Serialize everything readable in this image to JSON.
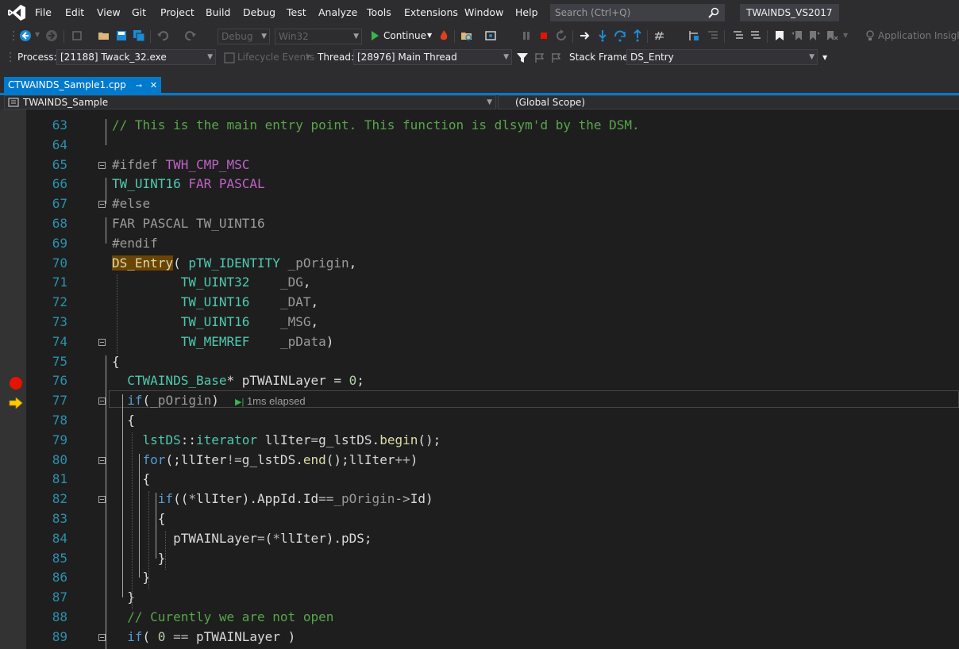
{
  "menubar": {
    "items": [
      "File",
      "Edit",
      "View",
      "Git",
      "Project",
      "Build",
      "Debug",
      "Test",
      "Analyze",
      "Tools",
      "Extensions",
      "Window",
      "Help"
    ],
    "search_placeholder": "Search (Ctrl+Q)",
    "solution_name": "TWAINDS_VS2017"
  },
  "toolbar": {
    "config": "Debug",
    "platform": "Win32",
    "continue_label": "Continue",
    "insights_label": "Application Insights"
  },
  "debug_location": {
    "process_label": "Process:",
    "process_value": "[21188] Twack_32.exe",
    "lifecycle_label": "Lifecycle Events",
    "thread_label": "Thread:",
    "thread_value": "[28976] Main Thread",
    "stackframe_label": "Stack Frame:",
    "stackframe_value": "DS_Entry"
  },
  "tab": {
    "filename": "CTWAINDS_Sample1.cpp",
    "pin": "⊸",
    "close": "✕"
  },
  "navbar": {
    "project": "TWAINDS_Sample",
    "scope": "(Global Scope)"
  },
  "perf_tip": "1ms elapsed",
  "colors": {
    "accent": "#007acc",
    "breakpoint": "#e51400",
    "current_line_arrow": "#ffcc00"
  },
  "code_lines": [
    {
      "n": "63",
      "tokens": [
        {
          "c": "cm",
          "t": "// This is the main entry point. This function is dlsym'd by the DSM."
        }
      ]
    },
    {
      "n": "64",
      "tokens": []
    },
    {
      "n": "65",
      "tokens": [
        {
          "c": "pp",
          "t": "#ifdef "
        },
        {
          "c": "mac",
          "t": "TWH_CMP_MSC"
        }
      ]
    },
    {
      "n": "66",
      "tokens": [
        {
          "c": "ty",
          "t": "TW_UINT16"
        },
        {
          "c": "",
          "t": " "
        },
        {
          "c": "mac",
          "t": "FAR"
        },
        {
          "c": "",
          "t": " "
        },
        {
          "c": "mac",
          "t": "PASCAL"
        }
      ]
    },
    {
      "n": "67",
      "tokens": [
        {
          "c": "pp",
          "t": "#else"
        }
      ]
    },
    {
      "n": "68",
      "tokens": [
        {
          "c": "pp",
          "t": "FAR PASCAL TW_UINT16"
        }
      ]
    },
    {
      "n": "69",
      "tokens": [
        {
          "c": "pp",
          "t": "#endif"
        }
      ]
    },
    {
      "n": "70",
      "tokens": [
        {
          "c": "fn highlight-entry",
          "t": "DS_Entry"
        },
        {
          "c": "",
          "t": "( "
        },
        {
          "c": "ty",
          "t": "pTW_IDENTITY"
        },
        {
          "c": "par",
          "t": " _pOrigin"
        },
        {
          "c": "",
          "t": ","
        }
      ]
    },
    {
      "n": "71",
      "tokens": [
        {
          "c": "",
          "t": "         "
        },
        {
          "c": "ty",
          "t": "TW_UINT32"
        },
        {
          "c": "par",
          "t": "    _DG"
        },
        {
          "c": "",
          "t": ","
        }
      ]
    },
    {
      "n": "72",
      "tokens": [
        {
          "c": "",
          "t": "         "
        },
        {
          "c": "ty",
          "t": "TW_UINT16"
        },
        {
          "c": "par",
          "t": "    _DAT"
        },
        {
          "c": "",
          "t": ","
        }
      ]
    },
    {
      "n": "73",
      "tokens": [
        {
          "c": "",
          "t": "         "
        },
        {
          "c": "ty",
          "t": "TW_UINT16"
        },
        {
          "c": "par",
          "t": "    _MSG"
        },
        {
          "c": "",
          "t": ","
        }
      ]
    },
    {
      "n": "74",
      "tokens": [
        {
          "c": "",
          "t": "         "
        },
        {
          "c": "ty",
          "t": "TW_MEMREF"
        },
        {
          "c": "par",
          "t": "    _pData"
        },
        {
          "c": "",
          "t": ")"
        }
      ]
    },
    {
      "n": "75",
      "tokens": [
        {
          "c": "",
          "t": "{"
        }
      ]
    },
    {
      "n": "76",
      "tokens": [
        {
          "c": "",
          "t": "  "
        },
        {
          "c": "ty",
          "t": "CTWAINDS_Base"
        },
        {
          "c": "",
          "t": "* "
        },
        {
          "c": "glob",
          "t": "pTWAINLayer"
        },
        {
          "c": "",
          "t": " = "
        },
        {
          "c": "num",
          "t": "0"
        },
        {
          "c": "",
          "t": ";"
        }
      ]
    },
    {
      "n": "77",
      "tokens": [
        {
          "c": "",
          "t": "  "
        },
        {
          "c": "kw",
          "t": "if"
        },
        {
          "c": "",
          "t": "("
        },
        {
          "c": "par",
          "t": "_pOrigin"
        },
        {
          "c": "",
          "t": ")"
        }
      ]
    },
    {
      "n": "78",
      "tokens": [
        {
          "c": "",
          "t": "  {"
        }
      ]
    },
    {
      "n": "79",
      "tokens": [
        {
          "c": "",
          "t": "    "
        },
        {
          "c": "ty",
          "t": "lstDS"
        },
        {
          "c": "",
          "t": "::"
        },
        {
          "c": "ty",
          "t": "iterator"
        },
        {
          "c": "",
          "t": " "
        },
        {
          "c": "glob",
          "t": "llIter"
        },
        {
          "c": "op",
          "t": "="
        },
        {
          "c": "glob",
          "t": "g_lstDS"
        },
        {
          "c": "",
          "t": "."
        },
        {
          "c": "fn",
          "t": "begin"
        },
        {
          "c": "",
          "t": "();"
        }
      ]
    },
    {
      "n": "80",
      "tokens": [
        {
          "c": "",
          "t": "    "
        },
        {
          "c": "kw",
          "t": "for"
        },
        {
          "c": "",
          "t": "(;"
        },
        {
          "c": "glob",
          "t": "llIter"
        },
        {
          "c": "op",
          "t": "!="
        },
        {
          "c": "glob",
          "t": "g_lstDS"
        },
        {
          "c": "",
          "t": "."
        },
        {
          "c": "fn",
          "t": "end"
        },
        {
          "c": "",
          "t": "();"
        },
        {
          "c": "glob",
          "t": "llIter"
        },
        {
          "c": "op",
          "t": "++"
        },
        {
          "c": "",
          "t": ")"
        }
      ]
    },
    {
      "n": "81",
      "tokens": [
        {
          "c": "",
          "t": "    {"
        }
      ]
    },
    {
      "n": "82",
      "tokens": [
        {
          "c": "",
          "t": "      "
        },
        {
          "c": "kw",
          "t": "if"
        },
        {
          "c": "",
          "t": "(("
        },
        {
          "c": "op",
          "t": "*"
        },
        {
          "c": "glob",
          "t": "llIter"
        },
        {
          "c": "",
          "t": ").AppId.Id"
        },
        {
          "c": "op",
          "t": "=="
        },
        {
          "c": "par",
          "t": "_pOrigin"
        },
        {
          "c": "op",
          "t": "->"
        },
        {
          "c": "",
          "t": "Id)"
        }
      ]
    },
    {
      "n": "83",
      "tokens": [
        {
          "c": "",
          "t": "      {"
        }
      ]
    },
    {
      "n": "84",
      "tokens": [
        {
          "c": "",
          "t": "        "
        },
        {
          "c": "glob",
          "t": "pTWAINLayer"
        },
        {
          "c": "op",
          "t": "="
        },
        {
          "c": "",
          "t": "("
        },
        {
          "c": "op",
          "t": "*"
        },
        {
          "c": "glob",
          "t": "llIter"
        },
        {
          "c": "",
          "t": ").pDS;"
        }
      ]
    },
    {
      "n": "85",
      "tokens": [
        {
          "c": "",
          "t": "      }"
        }
      ]
    },
    {
      "n": "86",
      "tokens": [
        {
          "c": "",
          "t": "    }"
        }
      ]
    },
    {
      "n": "87",
      "tokens": [
        {
          "c": "",
          "t": "  }"
        }
      ]
    },
    {
      "n": "88",
      "tokens": [
        {
          "c": "",
          "t": "  "
        },
        {
          "c": "cm",
          "t": "// Curently we are not open"
        }
      ]
    },
    {
      "n": "89",
      "tokens": [
        {
          "c": "",
          "t": "  "
        },
        {
          "c": "kw",
          "t": "if"
        },
        {
          "c": "",
          "t": "( "
        },
        {
          "c": "num",
          "t": "0"
        },
        {
          "c": "",
          "t": " "
        },
        {
          "c": "op",
          "t": "=="
        },
        {
          "c": "",
          "t": " "
        },
        {
          "c": "glob",
          "t": "pTWAINLayer"
        },
        {
          "c": "",
          "t": " )"
        }
      ]
    }
  ]
}
